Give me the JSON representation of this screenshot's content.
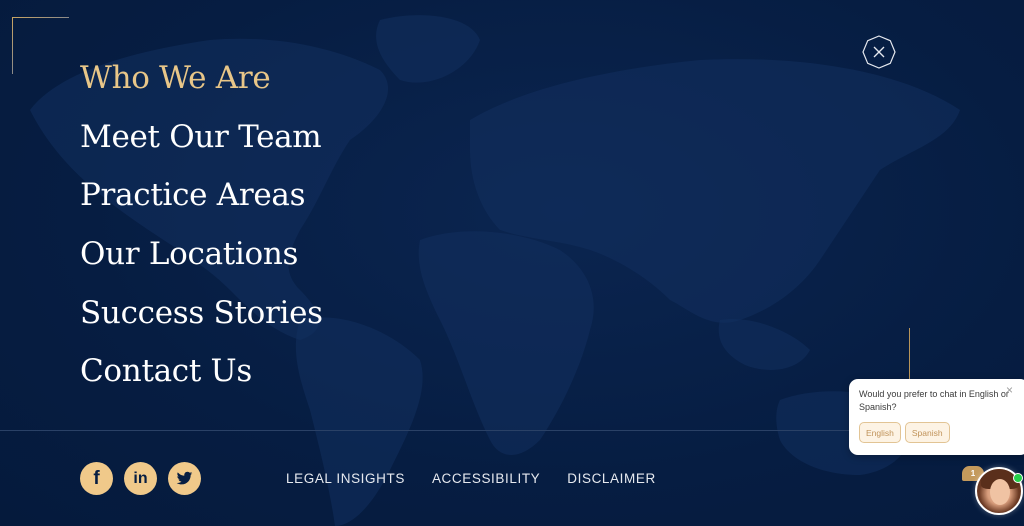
{
  "colors": {
    "background": "#061d42",
    "accent_gold": "#e8c688",
    "social_bg": "#f0c98a",
    "online_status": "#25d04a"
  },
  "nav": {
    "items": [
      {
        "label": "Who We Are",
        "active": true
      },
      {
        "label": "Meet Our Team",
        "active": false
      },
      {
        "label": "Practice Areas",
        "active": false
      },
      {
        "label": "Our Locations",
        "active": false
      },
      {
        "label": "Success Stories",
        "active": false
      },
      {
        "label": "Contact Us",
        "active": false
      }
    ]
  },
  "close_button": {
    "icon": "close-octagon-icon"
  },
  "social": [
    {
      "name": "facebook",
      "icon": "facebook-icon",
      "glyph": "f"
    },
    {
      "name": "linkedin",
      "icon": "linkedin-icon",
      "glyph": "in"
    },
    {
      "name": "twitter",
      "icon": "twitter-icon"
    }
  ],
  "footer_links": [
    "LEGAL INSIGHTS",
    "ACCESSIBILITY",
    "DISCLAIMER"
  ],
  "chat": {
    "message": "Would you prefer to chat in English or Spanish?",
    "close_glyph": "×",
    "options": [
      "English",
      "Spanish"
    ],
    "unread_count": "1",
    "agent_status": "online"
  }
}
